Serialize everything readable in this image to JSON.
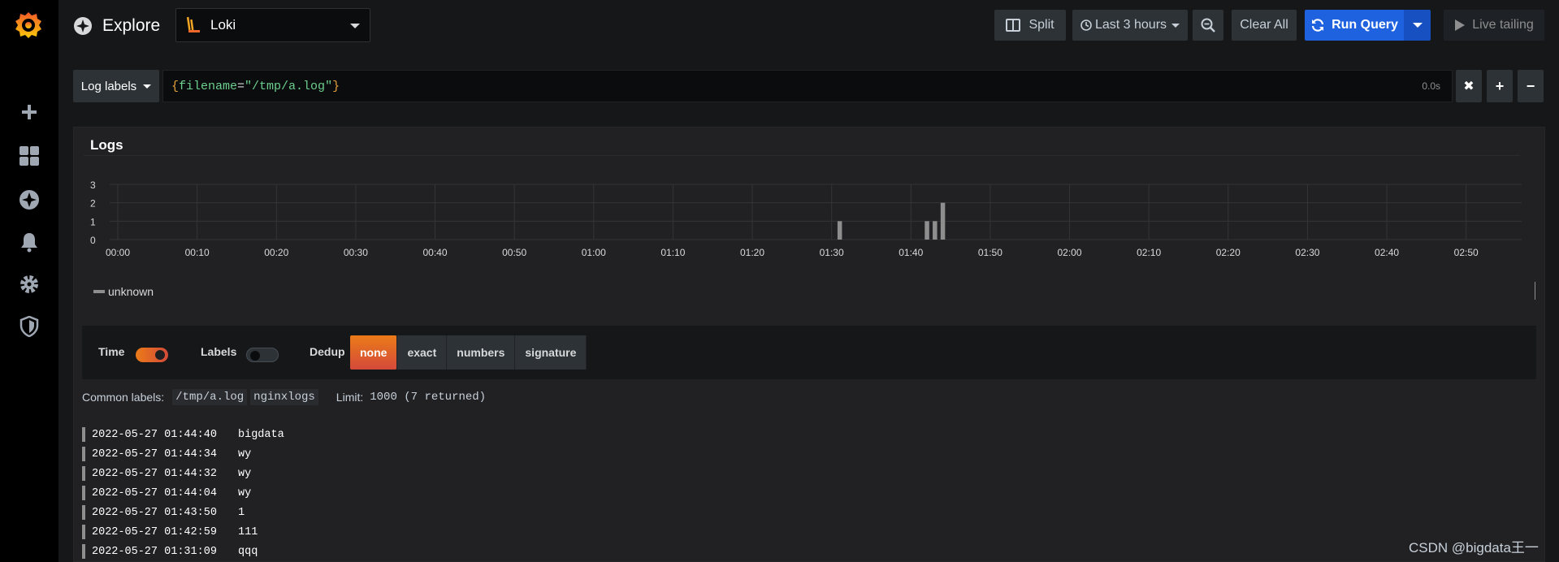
{
  "app": {
    "title": "Explore"
  },
  "datasource": {
    "name": "Loki"
  },
  "toolbar": {
    "split_label": "Split",
    "time_range_label": "Last 3 hours",
    "clear_label": "Clear All",
    "run_label": "Run Query",
    "live_label": "Live tailing"
  },
  "query": {
    "labels_button": "Log labels",
    "open_brace": "{",
    "key": "filename",
    "eq": "=",
    "value": "\"/tmp/a.log\"",
    "close_brace": "}",
    "duration": "0.0s"
  },
  "panel": {
    "title": "Logs"
  },
  "chart_data": {
    "type": "bar",
    "title": "",
    "xlabel": "",
    "ylabel": "",
    "ylim": [
      0,
      3
    ],
    "yticks": [
      "0",
      "1",
      "2",
      "3"
    ],
    "xticks": [
      "00:00",
      "00:10",
      "00:20",
      "00:30",
      "00:40",
      "00:50",
      "01:00",
      "01:10",
      "01:20",
      "01:30",
      "01:40",
      "01:50",
      "02:00",
      "02:10",
      "02:20",
      "02:30",
      "02:40",
      "02:50"
    ],
    "x_minutes_range": [
      0,
      177
    ],
    "grid": true,
    "legend": "bottom-left",
    "series": [
      {
        "name": "unknown",
        "color": "#8e8e8e",
        "x": [
          "01:31:00",
          "01:42:00",
          "01:43:00",
          "01:44:00"
        ],
        "values": [
          1,
          1,
          1,
          2
        ]
      }
    ]
  },
  "legend_label": "unknown",
  "options": {
    "time_label": "Time",
    "labels_label": "Labels",
    "dedup_label": "Dedup",
    "dedup_options": [
      "none",
      "exact",
      "numbers",
      "signature"
    ],
    "dedup_selected": "none",
    "time_on": true,
    "labels_on": false
  },
  "meta": {
    "common_labels_label": "Common labels:",
    "labels": [
      "/tmp/a.log",
      "nginxlogs"
    ],
    "limit_label": "Limit:",
    "limit_value": "1000 (7 returned)"
  },
  "logs": [
    {
      "ts": "2022-05-27 01:44:40",
      "msg": "bigdata"
    },
    {
      "ts": "2022-05-27 01:44:34",
      "msg": "wy"
    },
    {
      "ts": "2022-05-27 01:44:32",
      "msg": "wy"
    },
    {
      "ts": "2022-05-27 01:44:04",
      "msg": "wy"
    },
    {
      "ts": "2022-05-27 01:43:50",
      "msg": "1"
    },
    {
      "ts": "2022-05-27 01:42:59",
      "msg": "111"
    },
    {
      "ts": "2022-05-27 01:31:09",
      "msg": "qqq"
    }
  ],
  "watermark": "CSDN @bigdata王一",
  "colors": {
    "accent": "#eb7b18",
    "primary": "#1f62e0",
    "background": "#161719",
    "panel": "#212124"
  }
}
